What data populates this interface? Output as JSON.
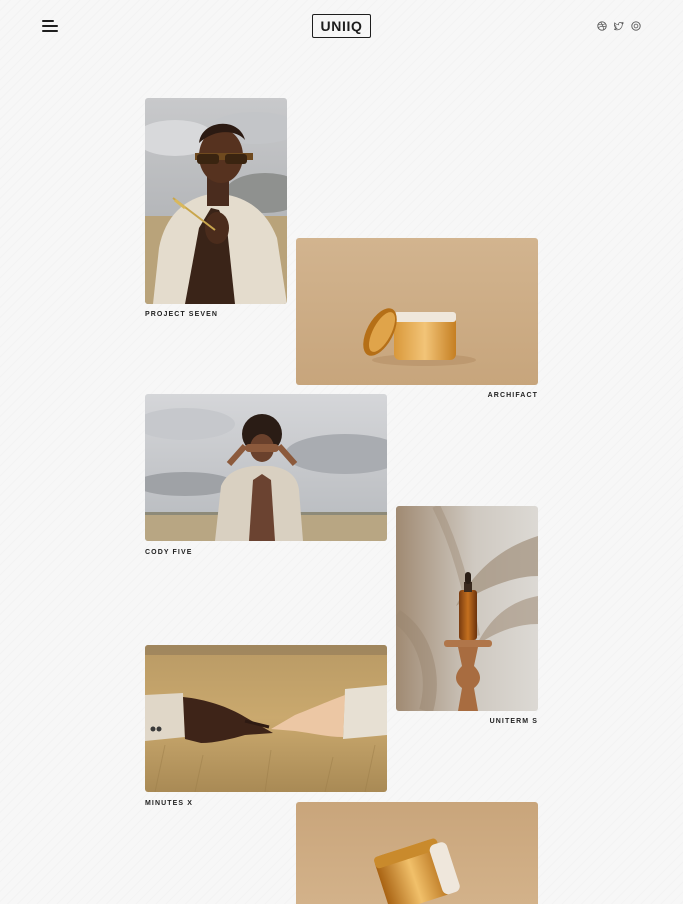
{
  "header": {
    "logo_text": "UNIIQ",
    "menu_icon": "hamburger-menu-icon",
    "social_icons": [
      "dribbble-icon",
      "twitter-icon",
      "instagram-icon"
    ]
  },
  "colors": {
    "background": "#f7f7f7",
    "text": "#1e1e1e",
    "sand": "#c8a57a",
    "amber": "#c07a1c"
  },
  "gallery": {
    "items": [
      {
        "title": "PROJECT SEVEN",
        "image": "man-with-sunglasses-in-field-photo"
      },
      {
        "title": "ARCHIFACT",
        "image": "cream-jar-product-photo"
      },
      {
        "title": "CODY FIVE",
        "image": "person-covering-eyes-in-field-photo"
      },
      {
        "title": "UNITERM S",
        "image": "dropper-bottle-on-pedestal-photo"
      },
      {
        "title": "MINUTES X",
        "image": "hands-reaching-over-wheat-photo"
      },
      {
        "title": "",
        "image": "cream-jar-close-up-photo"
      }
    ]
  }
}
